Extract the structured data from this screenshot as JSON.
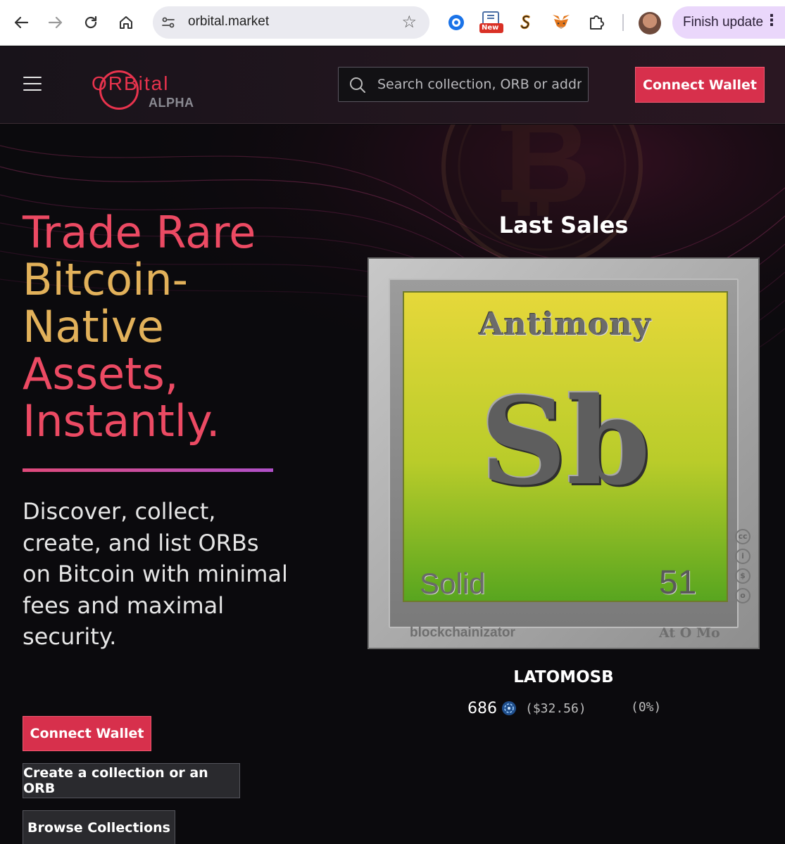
{
  "browser": {
    "url": "orbital.market",
    "new_badge": "New",
    "finish_update_label": "Finish update"
  },
  "header": {
    "logo_text": "ORBital",
    "logo_subtext": "ALPHA",
    "search_placeholder": "Search collection, ORB or address",
    "connect_wallet_label": "Connect Wallet"
  },
  "hero": {
    "headline_line1": "Trade Rare",
    "headline_line2": "Bitcoin-",
    "headline_line3": "Native",
    "headline_line4": "Assets,",
    "headline_line5": "Instantly.",
    "description": "Discover, collect, create, and list ORBs on Bitcoin with minimal fees and maximal security.",
    "connect_wallet_label": "Connect Wallet",
    "create_label": "Create a collection or an ORB",
    "browse_label": "Browse Collections"
  },
  "last_sales": {
    "title": "Last Sales",
    "card": {
      "element_name": "Antimony",
      "symbol": "Sb",
      "state": "Solid",
      "atomic_number": "51",
      "signature": "blockchainizator",
      "watermark": "At O Mo"
    },
    "item_name": "LATOMOSB",
    "price": "686",
    "price_usd": "($32.56)",
    "change": "(0%)"
  },
  "colors": {
    "accent_red": "#d7304c",
    "headline_red": "#ec4a63",
    "headline_gold": "#e2b15a"
  }
}
